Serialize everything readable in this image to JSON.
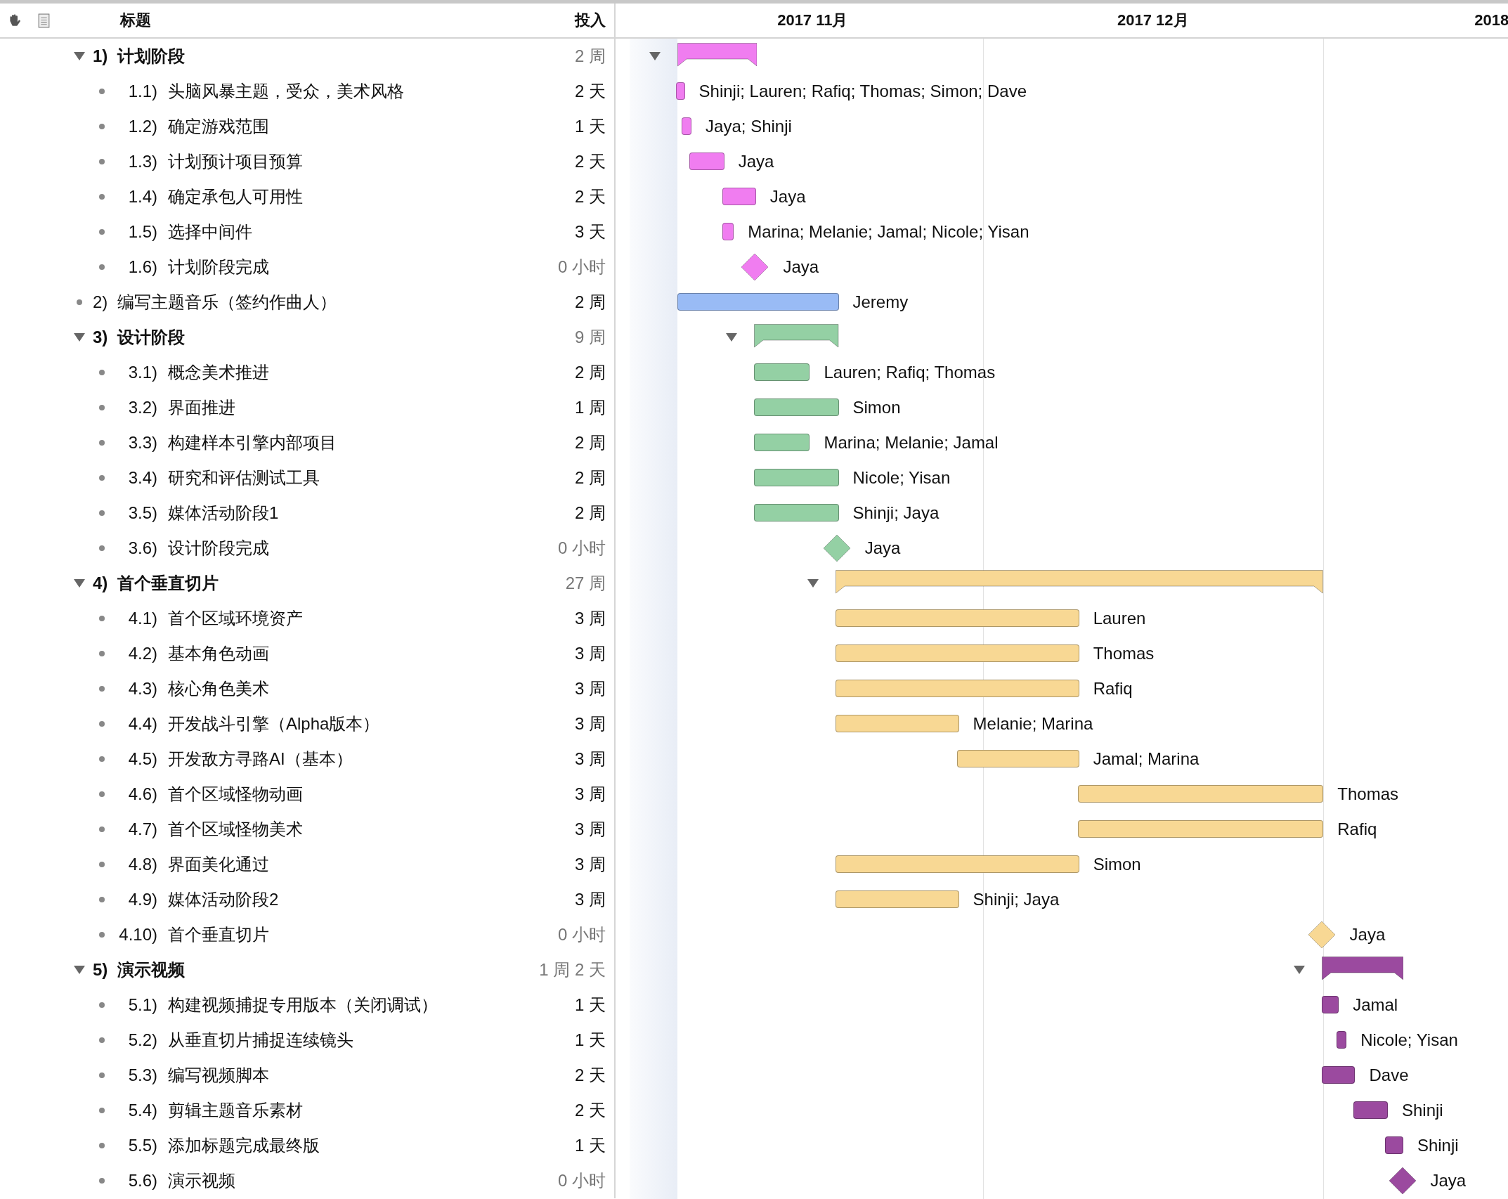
{
  "columns": {
    "title": "标题",
    "effort": "投入"
  },
  "timeline": {
    "months": [
      "2017 11月",
      "2017 12月",
      "2018"
    ]
  },
  "items": [
    {
      "number": "1)",
      "title": "计划阶段",
      "effort": "2 周",
      "kind": "group",
      "color": "#f07df0",
      "expanded": true,
      "children": [
        {
          "number": "1.1)",
          "title": "头脑风暴主题，受众，美术风格",
          "effort": "2 天",
          "kind": "task",
          "resources": "Shinji; Lauren; Rafiq; Thomas; Simon; Dave"
        },
        {
          "number": "1.2)",
          "title": "确定游戏范围",
          "effort": "1 天",
          "kind": "task",
          "resources": "Jaya; Shinji"
        },
        {
          "number": "1.3)",
          "title": "计划预计项目预算",
          "effort": "2 天",
          "kind": "task",
          "resources": "Jaya"
        },
        {
          "number": "1.4)",
          "title": "确定承包人可用性",
          "effort": "2 天",
          "kind": "task",
          "resources": "Jaya"
        },
        {
          "number": "1.5)",
          "title": "选择中间件",
          "effort": "3 天",
          "kind": "task",
          "resources": "Marina; Melanie; Jamal; Nicole; Yisan"
        },
        {
          "number": "1.6)",
          "title": "计划阶段完成",
          "effort": "0 小时",
          "kind": "milestone",
          "resources": "Jaya"
        }
      ]
    },
    {
      "number": "2)",
      "title": "编写主题音乐（签约作曲人）",
      "effort": "2 周",
      "kind": "task",
      "color": "#99bbf5",
      "resources": "Jeremy"
    },
    {
      "number": "3)",
      "title": "设计阶段",
      "effort": "9 周",
      "kind": "group",
      "color": "#94d0a4",
      "expanded": true,
      "children": [
        {
          "number": "3.1)",
          "title": "概念美术推进",
          "effort": "2 周",
          "kind": "task",
          "resources": "Lauren; Rafiq; Thomas"
        },
        {
          "number": "3.2)",
          "title": "界面推进",
          "effort": "1 周",
          "kind": "task",
          "resources": "Simon"
        },
        {
          "number": "3.3)",
          "title": "构建样本引擎内部项目",
          "effort": "2 周",
          "kind": "task",
          "resources": "Marina; Melanie; Jamal"
        },
        {
          "number": "3.4)",
          "title": "研究和评估测试工具",
          "effort": "2 周",
          "kind": "task",
          "resources": "Nicole; Yisan"
        },
        {
          "number": "3.5)",
          "title": "媒体活动阶段1",
          "effort": "2 周",
          "kind": "task",
          "resources": "Shinji; Jaya"
        },
        {
          "number": "3.6)",
          "title": "设计阶段完成",
          "effort": "0 小时",
          "kind": "milestone",
          "resources": "Jaya"
        }
      ]
    },
    {
      "number": "4)",
      "title": "首个垂直切片",
      "effort": "27 周",
      "kind": "group",
      "color": "#f8d894",
      "expanded": true,
      "children": [
        {
          "number": "4.1)",
          "title": "首个区域环境资产",
          "effort": "3 周",
          "kind": "task",
          "resources": "Lauren"
        },
        {
          "number": "4.2)",
          "title": "基本角色动画",
          "effort": "3 周",
          "kind": "task",
          "resources": "Thomas"
        },
        {
          "number": "4.3)",
          "title": "核心角色美术",
          "effort": "3 周",
          "kind": "task",
          "resources": "Rafiq"
        },
        {
          "number": "4.4)",
          "title": "开发战斗引擎（Alpha版本）",
          "effort": "3 周",
          "kind": "task",
          "resources": "Melanie; Marina"
        },
        {
          "number": "4.5)",
          "title": "开发敌方寻路AI（基本）",
          "effort": "3 周",
          "kind": "task",
          "resources": "Jamal; Marina"
        },
        {
          "number": "4.6)",
          "title": "首个区域怪物动画",
          "effort": "3 周",
          "kind": "task",
          "resources": "Thomas"
        },
        {
          "number": "4.7)",
          "title": "首个区域怪物美术",
          "effort": "3 周",
          "kind": "task",
          "resources": "Rafiq"
        },
        {
          "number": "4.8)",
          "title": "界面美化通过",
          "effort": "3 周",
          "kind": "task",
          "resources": "Simon"
        },
        {
          "number": "4.9)",
          "title": "媒体活动阶段2",
          "effort": "3 周",
          "kind": "task",
          "resources": "Shinji; Jaya"
        },
        {
          "number": "4.10)",
          "title": "首个垂直切片",
          "effort": "0 小时",
          "kind": "milestone",
          "resources": "Jaya"
        }
      ]
    },
    {
      "number": "5)",
      "title": "演示视频",
      "effort": "1 周 2 天",
      "kind": "group",
      "color": "#9b4a9f",
      "expanded": true,
      "children": [
        {
          "number": "5.1)",
          "title": "构建视频捕捉专用版本（关闭调试）",
          "effort": "1 天",
          "kind": "task",
          "resources": "Jamal"
        },
        {
          "number": "5.2)",
          "title": "从垂直切片捕捉连续镜头",
          "effort": "1 天",
          "kind": "task",
          "resources": "Nicole; Yisan"
        },
        {
          "number": "5.3)",
          "title": "编写视频脚本",
          "effort": "2 天",
          "kind": "task",
          "resources": "Dave"
        },
        {
          "number": "5.4)",
          "title": "剪辑主题音乐素材",
          "effort": "2 天",
          "kind": "task",
          "resources": "Shinji"
        },
        {
          "number": "5.5)",
          "title": "添加标题完成最终版",
          "effort": "1 天",
          "kind": "task",
          "resources": "Shinji"
        },
        {
          "number": "5.6)",
          "title": "演示视频",
          "effort": "0 小时",
          "kind": "milestone",
          "resources": "Jaya"
        }
      ]
    }
  ]
}
